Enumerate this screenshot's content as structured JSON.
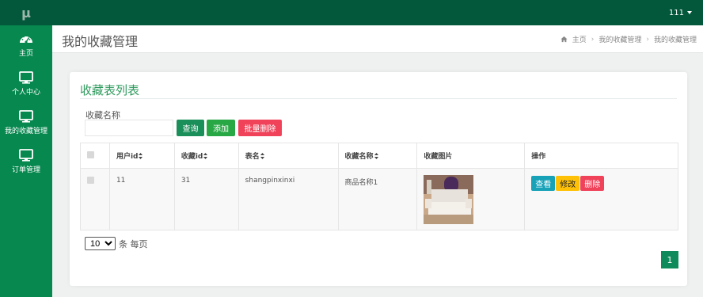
{
  "app": {
    "logo": "μ"
  },
  "user": {
    "name": "111"
  },
  "sidebar": {
    "items": [
      {
        "label": "主页",
        "icon": "dashboard-icon"
      },
      {
        "label": "个人中心",
        "icon": "monitor-icon"
      },
      {
        "label": "我的收藏管理",
        "icon": "monitor-icon"
      },
      {
        "label": "订单管理",
        "icon": "monitor-icon"
      }
    ]
  },
  "header": {
    "title": "我的收藏管理",
    "breadcrumb": [
      "主页",
      "我的收藏管理",
      "我的收藏管理"
    ]
  },
  "card": {
    "title": "收藏表列表"
  },
  "filter": {
    "label": "收藏名称",
    "value": "",
    "search_label": "查询",
    "add_label": "添加",
    "batch_delete_label": "批量删除"
  },
  "table": {
    "headers": [
      "用户id",
      "收藏id",
      "表名",
      "收藏名称",
      "收藏图片",
      "操作"
    ],
    "rows": [
      {
        "user_id": "11",
        "fav_id": "31",
        "table_name": "shangpinxinxi",
        "fav_name": "商品名称1",
        "image_icon": "bedroom-photo",
        "actions": [
          "查看",
          "修改",
          "删除"
        ]
      }
    ]
  },
  "pagination": {
    "page_size": "10",
    "page_size_options": [
      "10"
    ],
    "page_size_suffix": "条 每页",
    "current_page": "1"
  },
  "colors": {
    "topbar": "#03573a",
    "sidebar": "#07884f",
    "accent": "#2e9a5d",
    "view": "#17a2b8",
    "edit": "#ffc107",
    "delete": "#f0435a"
  }
}
